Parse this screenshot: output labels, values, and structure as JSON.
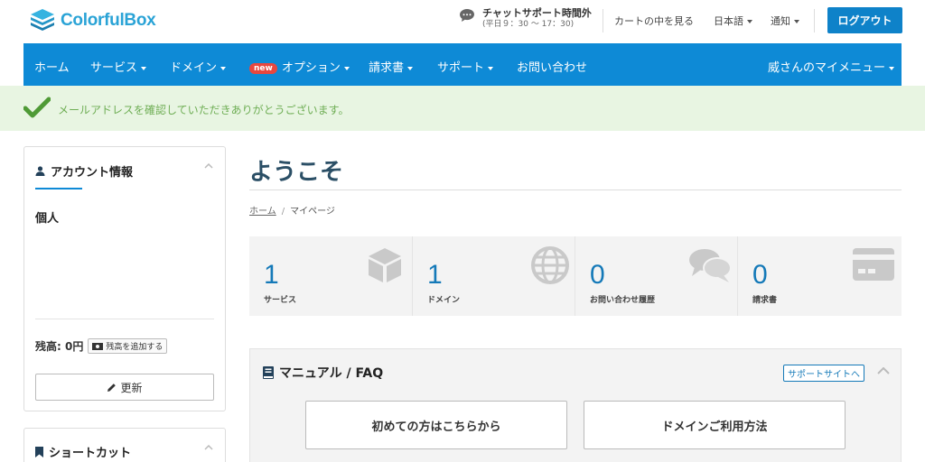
{
  "header": {
    "logo_text": "ColorfulBox",
    "chat_title": "チャットサポート時間外",
    "chat_sub": "(平日９：30 ～ 17：30)",
    "cart": "カートの中を見る",
    "language": "日本語",
    "notifications": "通知",
    "logout": "ログアウト"
  },
  "nav": {
    "items": [
      {
        "label": "ホーム"
      },
      {
        "label": "サービス"
      },
      {
        "label": "ドメイン"
      },
      {
        "label": "オプション",
        "badge": "new"
      },
      {
        "label": "請求書"
      },
      {
        "label": "サポート"
      },
      {
        "label": "お問い合わせ"
      }
    ],
    "user_menu": "威さんのマイメニュー"
  },
  "alert": {
    "text": "メールアドレスを確認していただきありがとうございます。"
  },
  "sidebar": {
    "account": {
      "title": "アカウント情報",
      "type": "個人",
      "balance": "残高: 0円",
      "add_balance": "残高を追加する",
      "update": "更新"
    },
    "shortcuts": {
      "title": "ショートカット"
    }
  },
  "main": {
    "title": "ようこそ",
    "breadcrumb": [
      "ホーム",
      "マイページ"
    ],
    "stats": [
      {
        "value": "1",
        "label": "サービス",
        "icon": "box-icon"
      },
      {
        "value": "1",
        "label": "ドメイン",
        "icon": "globe-icon"
      },
      {
        "value": "0",
        "label": "お問い合わせ履歴",
        "icon": "chat-bubbles-icon"
      },
      {
        "value": "0",
        "label": "請求書",
        "icon": "credit-card-icon"
      }
    ],
    "faq": {
      "title": "マニュアル / FAQ",
      "support_link": "サポートサイトへ",
      "buttons": [
        "初めての方はこちらから",
        "ドメインご利用方法"
      ]
    }
  },
  "colors": {
    "brand": "#2aa3d6",
    "nav": "#0e8ad6",
    "logout": "#0e82c9",
    "alert_bg": "#e8f5e2",
    "alert_text": "#6fae55",
    "stat_number": "#1479b8"
  }
}
